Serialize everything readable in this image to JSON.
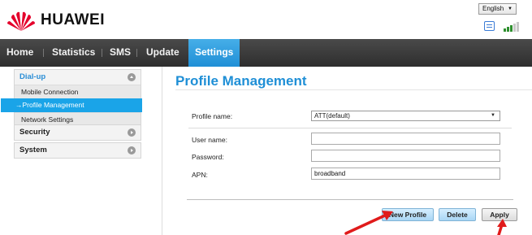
{
  "header": {
    "brand": "HUAWEI",
    "language": "English",
    "brand_color": "#e4002b"
  },
  "nav": {
    "items": [
      {
        "label": "Home"
      },
      {
        "label": "Statistics"
      },
      {
        "label": "SMS"
      },
      {
        "label": "Update"
      },
      {
        "label": "Settings",
        "active": true
      }
    ],
    "active_color": "#1f8fd6"
  },
  "sidebar": {
    "groups": [
      {
        "label": "Dial-up",
        "expanded": true,
        "items": [
          {
            "label": "Mobile Connection"
          },
          {
            "label": "→Profile Management",
            "active": true
          },
          {
            "label": "Network Settings"
          }
        ]
      },
      {
        "label": "Security",
        "expanded": false
      },
      {
        "label": "System",
        "expanded": false
      }
    ]
  },
  "main": {
    "title": "Profile Management",
    "form": {
      "profile_name_label": "Profile name:",
      "profile_name_value": "ATT(default)",
      "username_label": "User name:",
      "username_value": "",
      "password_label": "Password:",
      "password_value": "",
      "apn_label": "APN:",
      "apn_value": "broadband"
    },
    "buttons": {
      "new_profile": "New Profile",
      "delete": "Delete",
      "apply": "Apply"
    }
  },
  "annotations": {
    "arrow_color": "#e01b1b"
  }
}
